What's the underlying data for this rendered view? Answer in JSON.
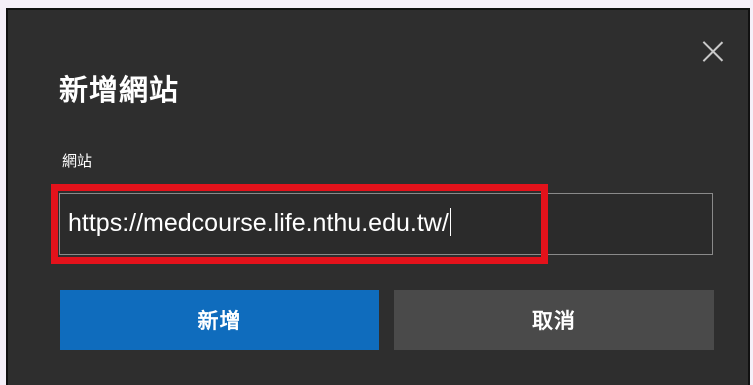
{
  "dialog": {
    "title": "新增網站",
    "field_label": "網站",
    "url_value": "https://medcourse.life.nthu.edu.tw/",
    "add_label": "新增",
    "cancel_label": "取消",
    "close_icon": "close-icon"
  },
  "colors": {
    "dialog_bg": "#2e2e2e",
    "primary": "#0f6cbd",
    "secondary": "#4a4a4a",
    "highlight": "#e3121b"
  }
}
